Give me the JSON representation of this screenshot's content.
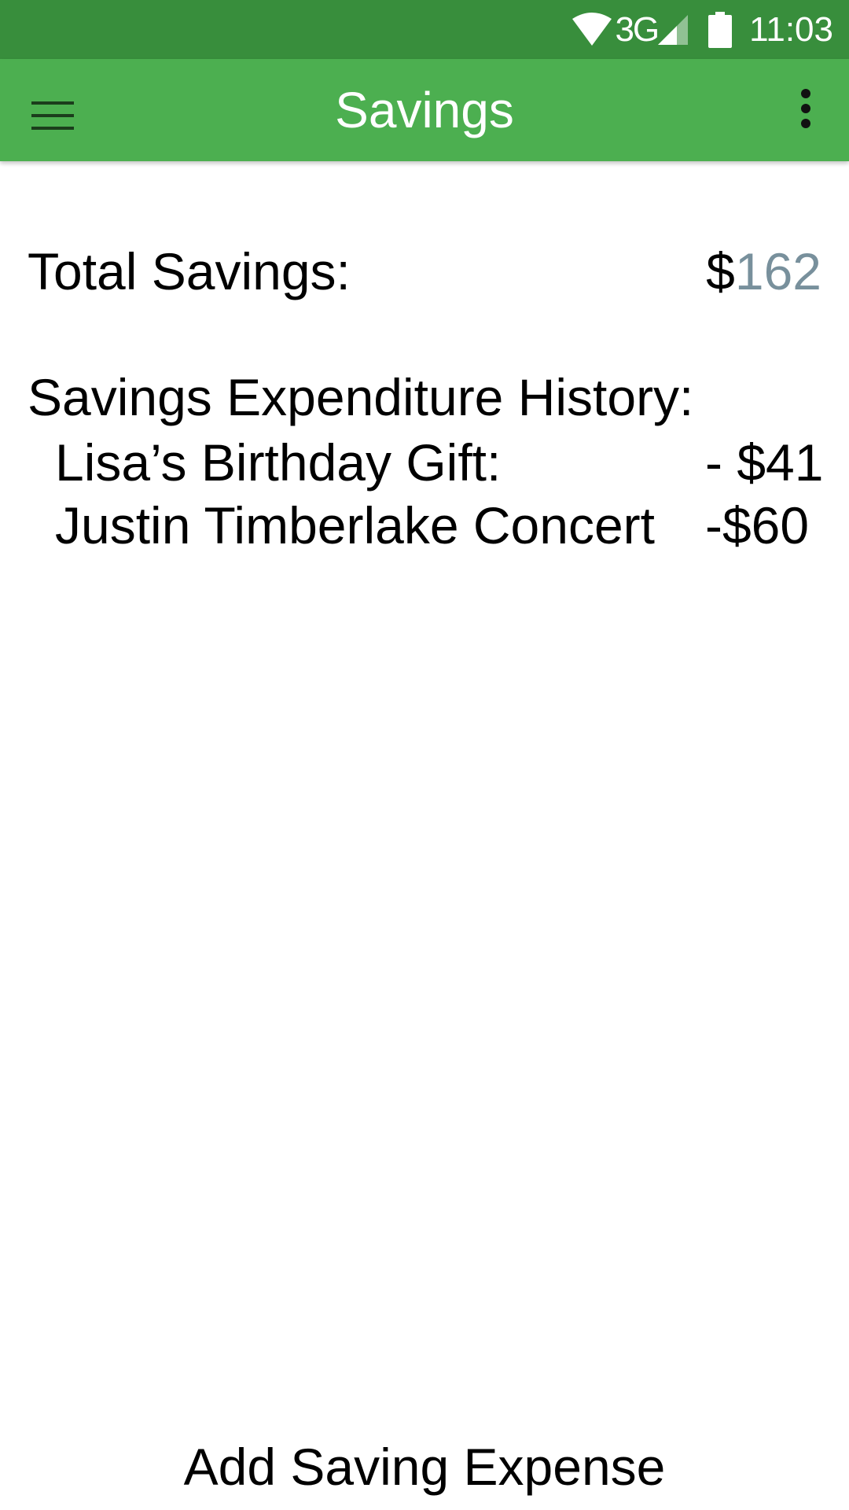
{
  "status_bar": {
    "network": "3G",
    "time": "11:03",
    "icons": [
      "wifi-icon",
      "cellular-signal-icon",
      "battery-icon"
    ]
  },
  "app_bar": {
    "title": "Savings",
    "icons": [
      "hamburger-menu-icon",
      "more-vert-icon"
    ]
  },
  "summary": {
    "total_label": "Total Savings:",
    "currency_symbol": "$",
    "total_amount": "162"
  },
  "history": {
    "title": "Savings Expenditure History:",
    "items": [
      {
        "name": "Lisa’s Birthday Gift:",
        "amount": "- $41"
      },
      {
        "name": "Justin Timberlake Concert",
        "amount": "-$60"
      }
    ]
  },
  "actions": {
    "add_expense_label": "Add Saving Expense"
  },
  "colors": {
    "status_bar": "#388E3C",
    "app_bar": "#4CAF50",
    "amount_accent": "#78909C"
  }
}
